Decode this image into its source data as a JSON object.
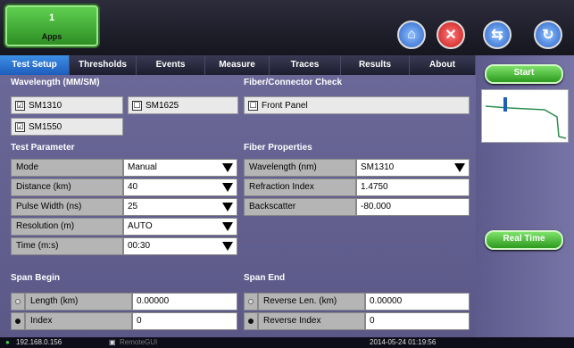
{
  "apps": {
    "count": "1",
    "label": "Apps"
  },
  "tabs": [
    "Test Setup",
    "Thresholds",
    "Events",
    "Measure",
    "Traces",
    "Results",
    "About"
  ],
  "right": {
    "start_label": "Start",
    "realtime_label": "Real Time"
  },
  "wavelength": {
    "title": "Wavelength (MM/SM)",
    "options": [
      {
        "label": "SM1310",
        "checked": "☑"
      },
      {
        "label": "SM1625",
        "checked": "☐"
      },
      {
        "label": "SM1550",
        "checked": "☑"
      }
    ]
  },
  "fiber_check": {
    "title": "Fiber/Connector Check",
    "option_label": "Front Panel",
    "checked": "☐"
  },
  "test_parameter": {
    "title": "Test Parameter",
    "rows": [
      {
        "label": "Mode",
        "value": "Manual"
      },
      {
        "label": "Distance (km)",
        "value": "40"
      },
      {
        "label": "Pulse Width (ns)",
        "value": "25"
      },
      {
        "label": "Resolution (m)",
        "value": "AUTO"
      },
      {
        "label": "Time (m:s)",
        "value": "00:30"
      }
    ]
  },
  "fiber_properties": {
    "title": "Fiber Properties",
    "rows": [
      {
        "label": "Wavelength (nm)",
        "value": "SM1310"
      },
      {
        "label": "Refraction Index",
        "value": "1.4750"
      },
      {
        "label": "Backscatter",
        "value": "-80.000"
      }
    ]
  },
  "span_begin": {
    "title": "Span Begin",
    "rows": [
      {
        "label": "Length (km)",
        "value": "0.00000",
        "selected": false
      },
      {
        "label": "Index",
        "value": "0",
        "selected": true
      }
    ]
  },
  "span_end": {
    "title": "Span End",
    "rows": [
      {
        "label": "Reverse Len. (km)",
        "value": "0.00000",
        "selected": false
      },
      {
        "label": "Reverse Index",
        "value": "0",
        "selected": true
      }
    ]
  },
  "status": {
    "ip": "192.168.0.156",
    "remote": "RemoteGUI",
    "datetime": "2014-05-24 01:19:56"
  }
}
